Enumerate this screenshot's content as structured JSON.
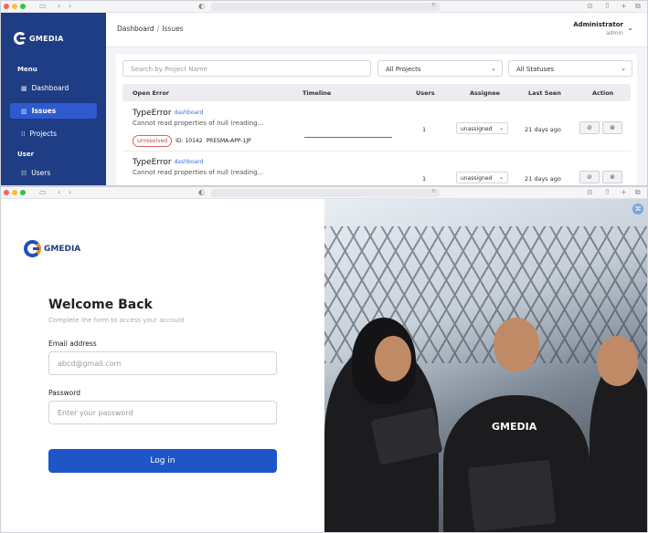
{
  "browser": {
    "icons": [
      "sidebar-icon",
      "back-icon",
      "forward-icon",
      "shield-icon",
      "reload-icon",
      "download-icon",
      "share-icon",
      "new-tab-icon",
      "tabs-icon"
    ]
  },
  "dashboard": {
    "brand": "GMEDIA",
    "sidebar": {
      "menu_header": "Menu",
      "user_header": "User",
      "items": [
        {
          "label": "Dashboard",
          "icon": "grid-icon"
        },
        {
          "label": "Issues",
          "icon": "bars-icon"
        },
        {
          "label": "Projects",
          "icon": "dots-grid-icon"
        },
        {
          "label": "Users",
          "icon": "users-icon"
        }
      ]
    },
    "breadcrumb": {
      "root": "Dashboard",
      "sep": "/",
      "current": "Issues"
    },
    "user": {
      "name": "Administrator",
      "role": "admin"
    },
    "filters": {
      "search_placeholder": "Search by Project Name",
      "project": "All Projects",
      "status": "All Statuses"
    },
    "columns": [
      "Open Error",
      "Timeline",
      "Users",
      "Assignee",
      "Last Seen",
      "Action"
    ],
    "rows": [
      {
        "type": "TypeError",
        "tag": "dashboard",
        "message": "Cannot read properties of null (reading...",
        "status": "unresolved",
        "id": "ID: 10142",
        "project": "PRESMA-APP-1JP",
        "users": "1",
        "assignee": "unassigned",
        "last_seen": "21 days ago"
      },
      {
        "type": "TypeError",
        "tag": "dashboard",
        "message": "Cannot read properties of null (reading...",
        "users": "1",
        "assignee": "unassigned",
        "last_seen": "21 days ago"
      }
    ]
  },
  "login": {
    "brand": "GMEDIA",
    "title": "Welcome Back",
    "subtitle": "Complete the form to access your account",
    "email_label": "Email address",
    "email_placeholder": "abcd@gmail.com",
    "password_label": "Password",
    "password_placeholder": "Enter your password",
    "button": "Log in",
    "photo_shirt_text": "GMEDIA"
  }
}
